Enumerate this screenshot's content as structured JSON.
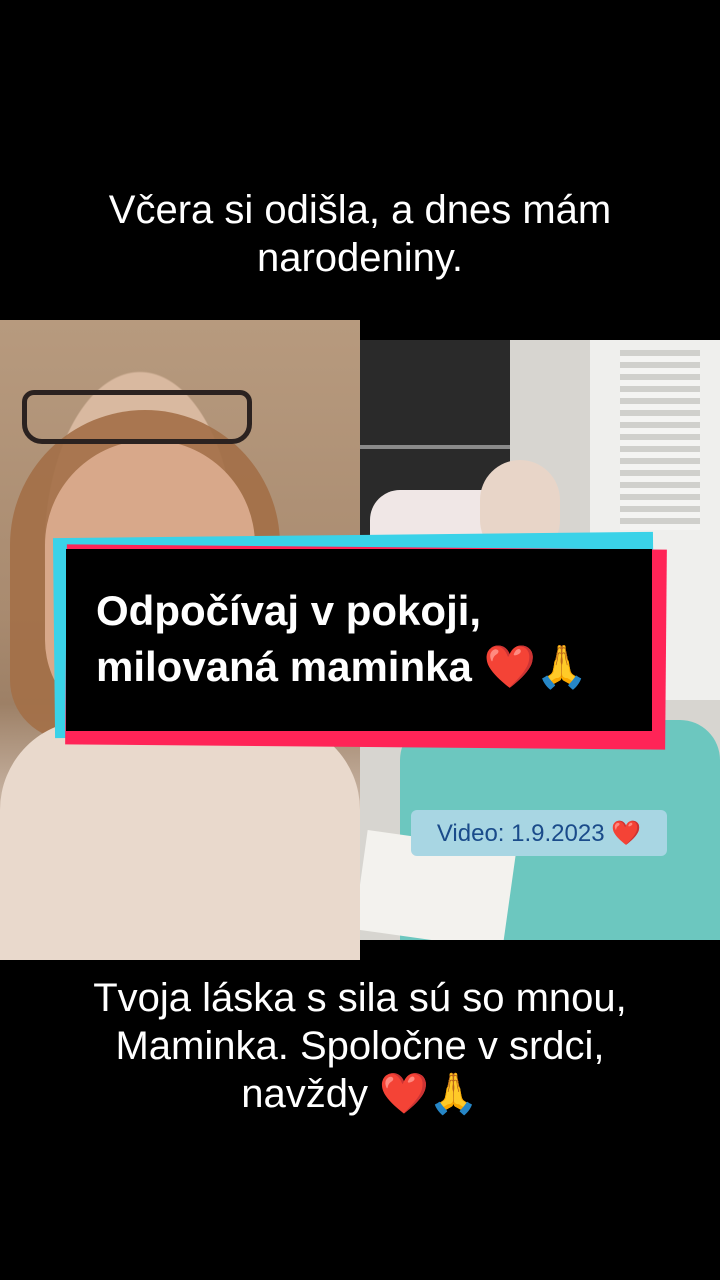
{
  "top_caption": {
    "line1": "Včera si odišla, a dnes mám",
    "line2": "narodeniny."
  },
  "overlay": {
    "line1": "Odpočívaj v pokoji,",
    "line2": "milovaná maminka ❤️🙏"
  },
  "video_badge": "Video: 1.9.2023 ❤️",
  "bottom_caption": {
    "line1": "Tvoja láska s sila sú so mnou,",
    "line2": "Maminka. Spoločne v srdci,",
    "line3": "navždy ❤️🙏"
  },
  "colors": {
    "background": "#000000",
    "tag_cyan": "#3ad2e8",
    "tag_red": "#ff2457",
    "badge_bg": "#a8d6e3",
    "badge_text": "#1a4b8a"
  }
}
